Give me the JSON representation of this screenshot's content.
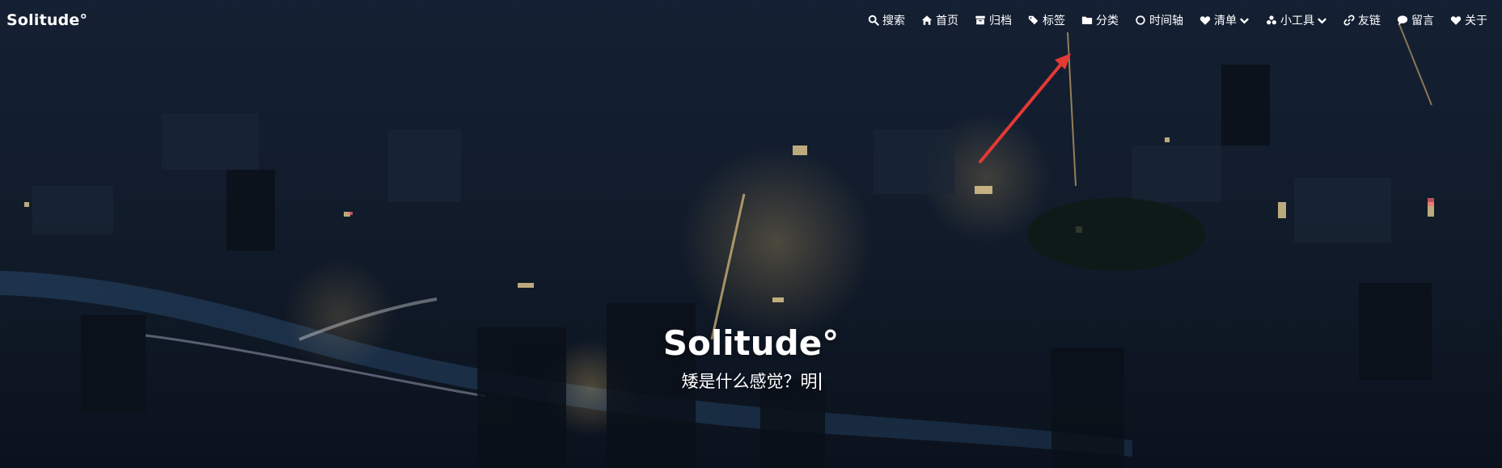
{
  "header": {
    "brand": "Solitude°"
  },
  "menu": {
    "items": [
      {
        "label": "搜索",
        "icon": "search-icon"
      },
      {
        "label": "首页",
        "icon": "home-icon"
      },
      {
        "label": "归档",
        "icon": "archive-icon"
      },
      {
        "label": "标签",
        "icon": "tags-icon"
      },
      {
        "label": "分类",
        "icon": "folder-icon"
      },
      {
        "label": "时间轴",
        "icon": "circle-icon"
      },
      {
        "label": "清单",
        "icon": "heartbeat-icon",
        "dropdown": true
      },
      {
        "label": "小工具",
        "icon": "tools-icon",
        "dropdown": true
      },
      {
        "label": "友链",
        "icon": "link-icon"
      },
      {
        "label": "留言",
        "icon": "comment-icon"
      },
      {
        "label": "关于",
        "icon": "heart-icon"
      }
    ]
  },
  "hero": {
    "title": "Solitude°",
    "subtitle": "矮是什么感觉？明"
  },
  "colors": {
    "text": "#ffffff",
    "annotation_arrow": "#e53935",
    "background_dark": "#0e1622"
  }
}
